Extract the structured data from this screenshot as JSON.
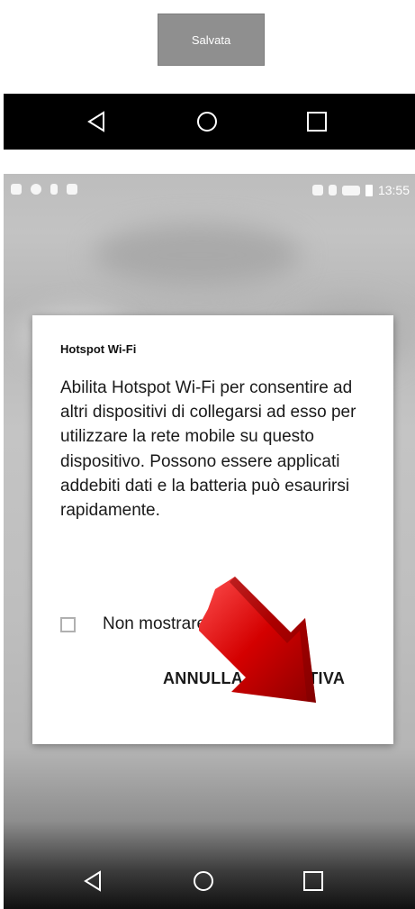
{
  "toast": {
    "text": "Salvata"
  },
  "status_bar": {
    "time": "13:55"
  },
  "dialog": {
    "title": "Hotspot Wi-Fi",
    "body": "Abilita Hotspot Wi-Fi per consentire ad altri dispositivi di collegarsi ad esso per utilizzare la rete mobile su questo dispositivo. Possono essere applicati addebiti dati e la batteria può esaurirsi rapidamente.",
    "checkbox_label": "Non mostrare più",
    "cancel_label": "ANNULLA",
    "confirm_label": "ATTIVA"
  },
  "colors": {
    "arrow": "#d40000",
    "toast_bg": "#8f8f8f"
  },
  "icons": [
    "back-icon",
    "home-icon",
    "recent-apps-icon"
  ]
}
